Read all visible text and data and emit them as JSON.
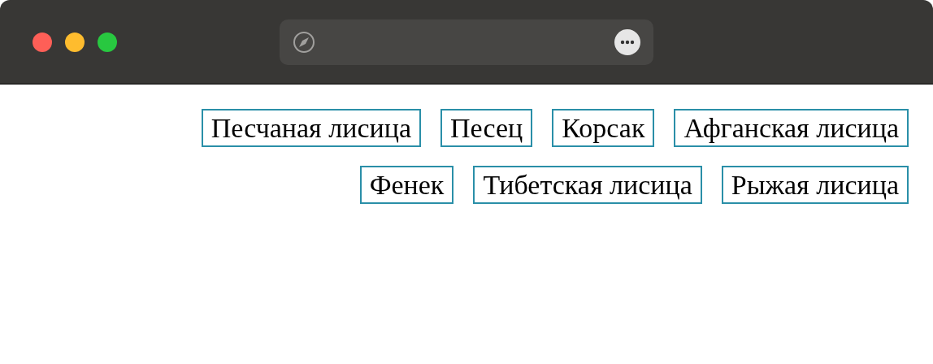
{
  "tags": [
    {
      "label": "Песчаная лисица"
    },
    {
      "label": "Песец"
    },
    {
      "label": "Корсак"
    },
    {
      "label": "Афганская лисица"
    },
    {
      "label": "Фенек"
    },
    {
      "label": "Тибетская лисица"
    },
    {
      "label": "Рыжая лисица"
    }
  ]
}
